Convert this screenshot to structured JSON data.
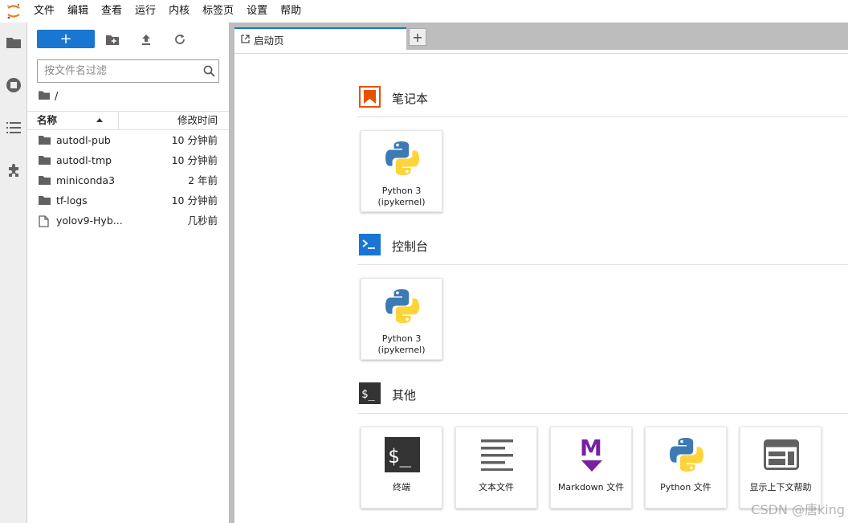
{
  "menubar": {
    "items": [
      "文件",
      "编辑",
      "查看",
      "运行",
      "内核",
      "标签页",
      "设置",
      "帮助"
    ]
  },
  "activitybar": {
    "icons": [
      "folder-icon",
      "running-icon",
      "toc-icon",
      "extension-icon"
    ]
  },
  "filebrowser": {
    "new_label": "+",
    "filter_placeholder": "按文件名过滤",
    "breadcrumb": "/",
    "columns": {
      "name": "名称",
      "modified": "修改时间"
    },
    "files": [
      {
        "name": "autodl-pub",
        "time": "10 分钟前",
        "type": "folder"
      },
      {
        "name": "autodl-tmp",
        "time": "10 分钟前",
        "type": "folder"
      },
      {
        "name": "miniconda3",
        "time": "2 年前",
        "type": "folder"
      },
      {
        "name": "tf-logs",
        "time": "10 分钟前",
        "type": "folder"
      },
      {
        "name": "yolov9-Hyb...",
        "time": "几秒前",
        "type": "file"
      }
    ]
  },
  "tabs": {
    "active_label": "启动页",
    "add_label": "+"
  },
  "launcher": {
    "sections": {
      "notebook": "笔记本",
      "console": "控制台",
      "other": "其他"
    },
    "notebook_cards": [
      {
        "line1": "Python 3",
        "line2": "(ipykernel)"
      }
    ],
    "console_cards": [
      {
        "line1": "Python 3",
        "line2": "(ipykernel)"
      }
    ],
    "other_cards": [
      {
        "label": "终端"
      },
      {
        "label": "文本文件"
      },
      {
        "label": "Markdown 文件"
      },
      {
        "label": "Python 文件"
      },
      {
        "label": "显示上下文帮助"
      }
    ]
  },
  "watermark": "CSDN @唐king",
  "colors": {
    "accent": "#1976d2",
    "notebook": "#e65100",
    "console": "#1976d2",
    "markdown": "#7b1fa2"
  }
}
